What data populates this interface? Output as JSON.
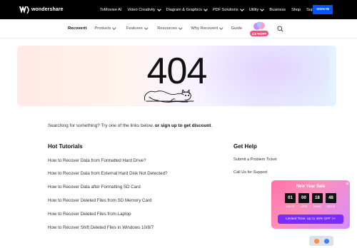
{
  "brand": {
    "name": "wondershare"
  },
  "topnav": {
    "items": [
      {
        "label": "ToMoviee AI",
        "has_dropdown": false
      },
      {
        "label": "Video Creativity",
        "has_dropdown": true
      },
      {
        "label": "Diagram & Graphics",
        "has_dropdown": true
      },
      {
        "label": "PDF Solutions",
        "has_dropdown": true
      },
      {
        "label": "Utility",
        "has_dropdown": true
      },
      {
        "label": "Business",
        "has_dropdown": false
      },
      {
        "label": "Shop",
        "has_dropdown": false
      },
      {
        "label": "Support",
        "has_dropdown": false
      }
    ],
    "signin_label": "SIGN IN",
    "signin_color": "#0055ff"
  },
  "subnav": {
    "items": [
      {
        "label": "Recoverit",
        "active": true,
        "has_dropdown": false
      },
      {
        "label": "Products",
        "active": false,
        "has_dropdown": true
      },
      {
        "label": "Features",
        "active": false,
        "has_dropdown": true
      },
      {
        "label": "Resources",
        "active": false,
        "has_dropdown": true
      },
      {
        "label": "Why Recoverit",
        "active": false,
        "has_dropdown": true
      },
      {
        "label": "Guide",
        "active": false,
        "has_dropdown": false
      }
    ],
    "promo_tag": "4.5 %OFF",
    "search_icon": "search-icon"
  },
  "hero": {
    "error_code": "404",
    "illustration": "cat-line-drawing"
  },
  "intro": {
    "text": "Searching for something? Try one of the links below, ",
    "strong": "or sign up to get discount",
    "end": "."
  },
  "tutorials": {
    "title": "Hot Tutorials",
    "links": [
      "How to Recover Data from Formatted Hard Drive?",
      "How to Recover Data from External Hard Disk Not Detected?",
      "How to Recover Data after Formatting SD Card",
      "How to Recover Deleted Files from SD Memory Card",
      "How to Recover Deleted Files from Laptop",
      "How to Recover Shift Deleted Files in Windows 10/8/7"
    ]
  },
  "help": {
    "title": "Get Help",
    "links": [
      "Submit a Problem Ticket",
      "Call Us for Support"
    ]
  },
  "sale": {
    "title": "New Year Sale",
    "timer": [
      {
        "value": "01",
        "label": "DAYS"
      },
      {
        "value": "00",
        "label": "HRS"
      },
      {
        "value": "18",
        "label": "MINS"
      },
      {
        "value": "48",
        "label": "SECS"
      }
    ],
    "cta": "Limited Time: Up to 45% OFF >>",
    "cta_color": "#7a2cff"
  },
  "tray": {
    "icons": [
      "chat-icon",
      "app-icon"
    ]
  }
}
